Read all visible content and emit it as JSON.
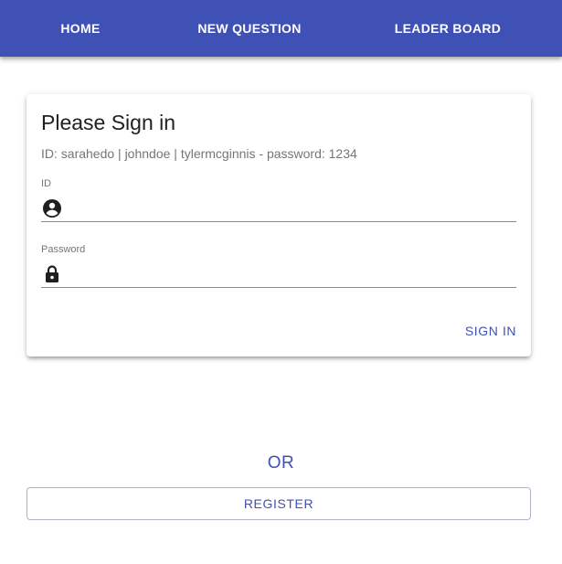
{
  "nav": {
    "tabs": [
      {
        "label": "HOME"
      },
      {
        "label": "NEW QUESTION"
      },
      {
        "label": "LEADER BOARD"
      }
    ],
    "background_color": "#3f51b5"
  },
  "signin_card": {
    "title": "Please Sign in",
    "hint": "ID: sarahedo | johndoe | tylermcginnis - password: 1234",
    "id_field": {
      "label": "ID",
      "value": "",
      "icon": "account-circle-icon"
    },
    "password_field": {
      "label": "Password",
      "value": "",
      "icon": "lock-icon"
    },
    "submit_label": "SIGN IN"
  },
  "divider_text": "OR",
  "register_label": "REGISTER",
  "accent_color": "#3f51b5"
}
